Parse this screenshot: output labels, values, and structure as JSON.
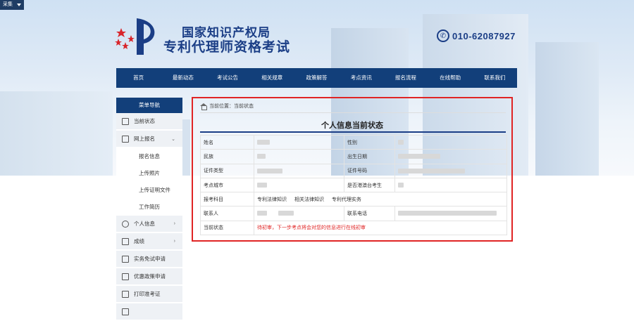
{
  "toolbar": {
    "collect_label": "采集"
  },
  "header": {
    "title_line1": "国家知识产权局",
    "title_line2": "专利代理师资格考试",
    "phone": "010-62087927"
  },
  "nav": {
    "items": [
      "首页",
      "最新动态",
      "考试公告",
      "相关规章",
      "政策解答",
      "考点资讯",
      "报名流程",
      "在线帮助",
      "联系我们"
    ]
  },
  "sidebar": {
    "heading": "菜单导航",
    "current_status": "当前状态",
    "online_register": "网上报名",
    "sub_items": [
      "报名信息",
      "上传照片",
      "上传证明文件",
      "工作简历"
    ],
    "personal_info": "个人信息",
    "scores": "成绩",
    "exemption": "实务免试申请",
    "preferential": "优惠政策申请",
    "print_ticket": "打印准考证"
  },
  "breadcrumb": {
    "label": "当前位置：当前状态"
  },
  "panel": {
    "title": "个人信息当前状态",
    "labels": {
      "name": "姓名",
      "gender": "性别",
      "ethnicity": "民族",
      "birth_date": "出生日期",
      "id_type": "证件类型",
      "id_number": "证件号码",
      "exam_city": "考点城市",
      "hk_macao_tw": "是否港澳台考生",
      "subjects": "报考科目",
      "contact_person": "联系人",
      "contact_phone": "联系电话",
      "current_status": "当前状态"
    },
    "subjects": [
      "专利法律知识",
      "相关法律知识",
      "专利代理实务"
    ],
    "status_text": "待初审，下一步考点将会对您的信息进行在线初审"
  }
}
